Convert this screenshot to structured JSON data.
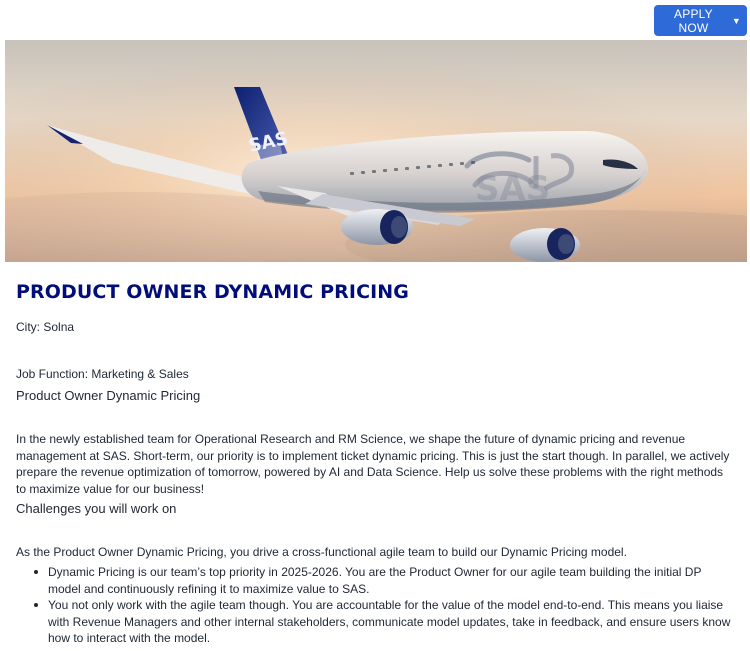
{
  "header": {
    "apply_button_label": "APPLY NOW",
    "apply_button_icon": "caret-down-icon"
  },
  "hero": {
    "image_description": "",
    "airline_mark": "SAS",
    "colors": {
      "sky": "#d9c5b3",
      "brand_blue": "#2f6bd8",
      "title_blue": "#000d7b"
    }
  },
  "job": {
    "title": "PRODUCT OWNER DYNAMIC PRICING",
    "city_label": "City:",
    "city_value": "Solna",
    "function_label": "Job Function:",
    "function_value": "Marketing & Sales",
    "subtitle": "Product Owner Dynamic Pricing",
    "intro": "In the newly established team for Operational Research and RM Science, we shape the future of dynamic pricing and revenue management at SAS. Short-term, our priority is to implement ticket dynamic pricing. This is just the start though. In parallel, we actively prepare the revenue optimization of tomorrow, powered by AI and Data Science. Help us solve these problems with the right methods to maximize value for our business!",
    "challenges_heading": "Challenges you will work on",
    "role_intro": "As the Product Owner Dynamic Pricing, you drive a cross-functional agile team to build our Dynamic Pricing model.",
    "bullets": [
      "Dynamic Pricing is our team’s top priority in 2025-2026. You are the Product Owner for our agile team building the initial DP model and continuously refining it to maximize value to SAS.",
      "You not only work with the agile team though. You are accountable for the value of the model end-to-end. This means you liaise with Revenue Managers and other internal stakeholders, communicate model updates, take in feedback, and ensure users know how to interact with the model."
    ]
  }
}
